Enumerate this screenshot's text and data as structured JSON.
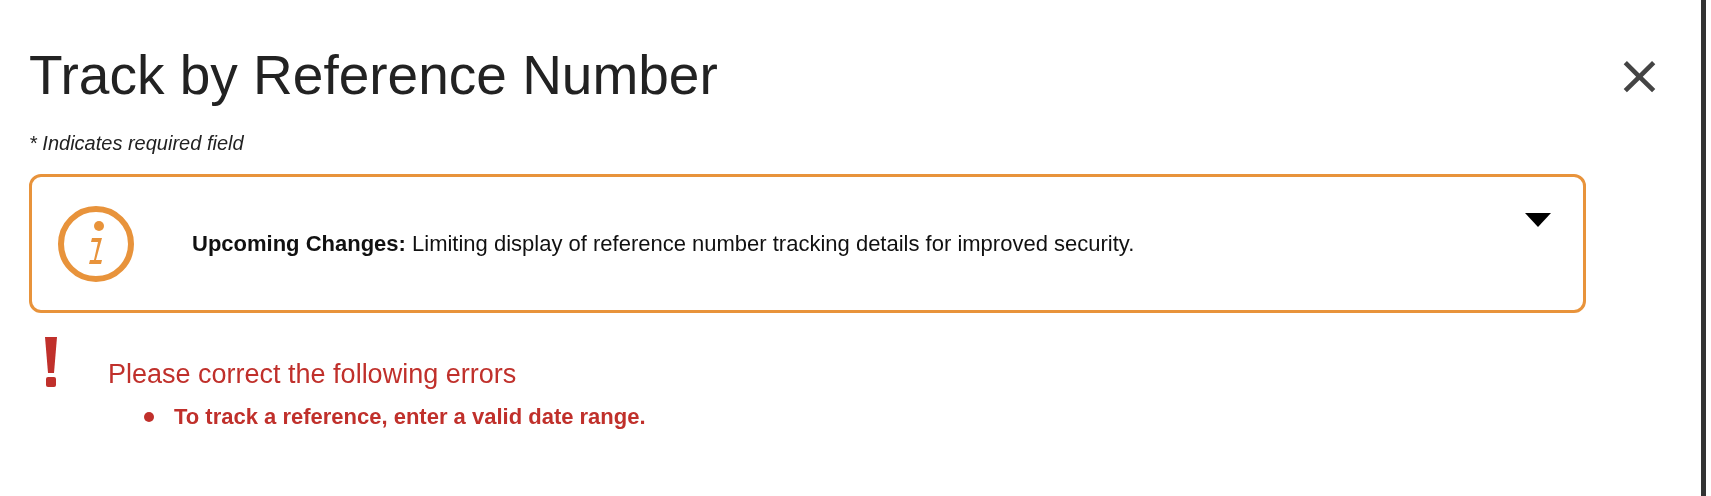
{
  "dialog": {
    "title": "Track by Reference Number",
    "close": "×"
  },
  "required_note": "* Indicates required field",
  "notice": {
    "kind": "info",
    "expanded": false,
    "text": "**Upcoming Changes:** Limiting display of reference number tracking details for improved security."
  },
  "errors": {
    "heading": "Please correct the following errors",
    "items": [
      "To track a reference, enter a valid date range."
    ]
  }
}
